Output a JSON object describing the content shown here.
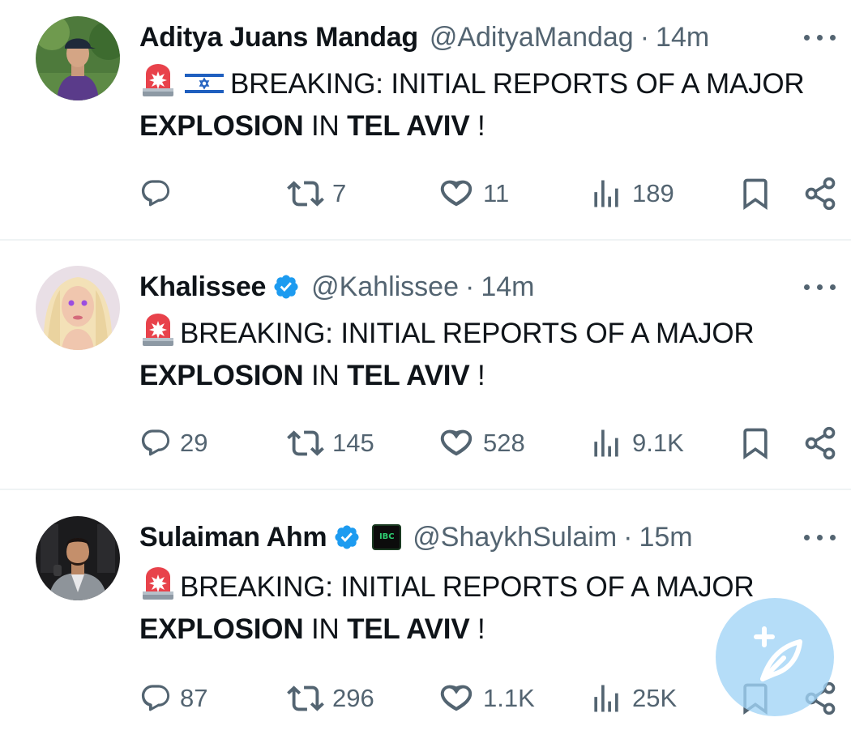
{
  "tweets": [
    {
      "name": "Aditya Juans Mandag",
      "handle": "@AdityaMandag",
      "time": "14m",
      "verified": false,
      "text": {
        "line1_rest": "BREAKING: INITIAL REPORTS OF A MAJOR",
        "bold1": "EXPLOSION",
        "mid": " IN ",
        "bold2": "TEL AVIV",
        "end": " !"
      },
      "stats": {
        "replies": "",
        "retweets": "7",
        "likes": "11",
        "views": "189"
      }
    },
    {
      "name": "Khalissee",
      "handle": "@Kahlissee",
      "time": "14m",
      "verified": true,
      "text": {
        "line1_rest": "BREAKING: INITIAL REPORTS OF A MAJOR",
        "bold1": "EXPLOSION",
        "mid": " IN ",
        "bold2": "TEL AVIV",
        "end": " !"
      },
      "stats": {
        "replies": "29",
        "retweets": "145",
        "likes": "528",
        "views": "9.1K"
      }
    },
    {
      "name": "Sulaiman Ahm",
      "handle": "@ShaykhSulaim",
      "time": "15m",
      "verified": true,
      "org_badge": "IBC",
      "text": {
        "line1_rest": "BREAKING: INITIAL REPORTS OF A MAJOR",
        "bold1": "EXPLOSION",
        "mid": " IN ",
        "bold2": "TEL AVIV",
        "end": " !"
      },
      "stats": {
        "replies": "87",
        "retweets": "296",
        "likes": "1.1K",
        "views": "25K"
      }
    }
  ],
  "icons": {
    "siren": "police-car-light-emoji",
    "flag": "israel-flag-emoji",
    "reply": "comment-icon",
    "retweet": "retweet-icon",
    "like": "heart-icon",
    "views": "bar-chart-icon",
    "bookmark": "bookmark-icon",
    "share": "share-icon",
    "compose": "feather-plus-icon"
  },
  "colors": {
    "verified": "#1d9bf0",
    "secondary_text": "#536471",
    "compose_button": "#a0d4f6"
  }
}
